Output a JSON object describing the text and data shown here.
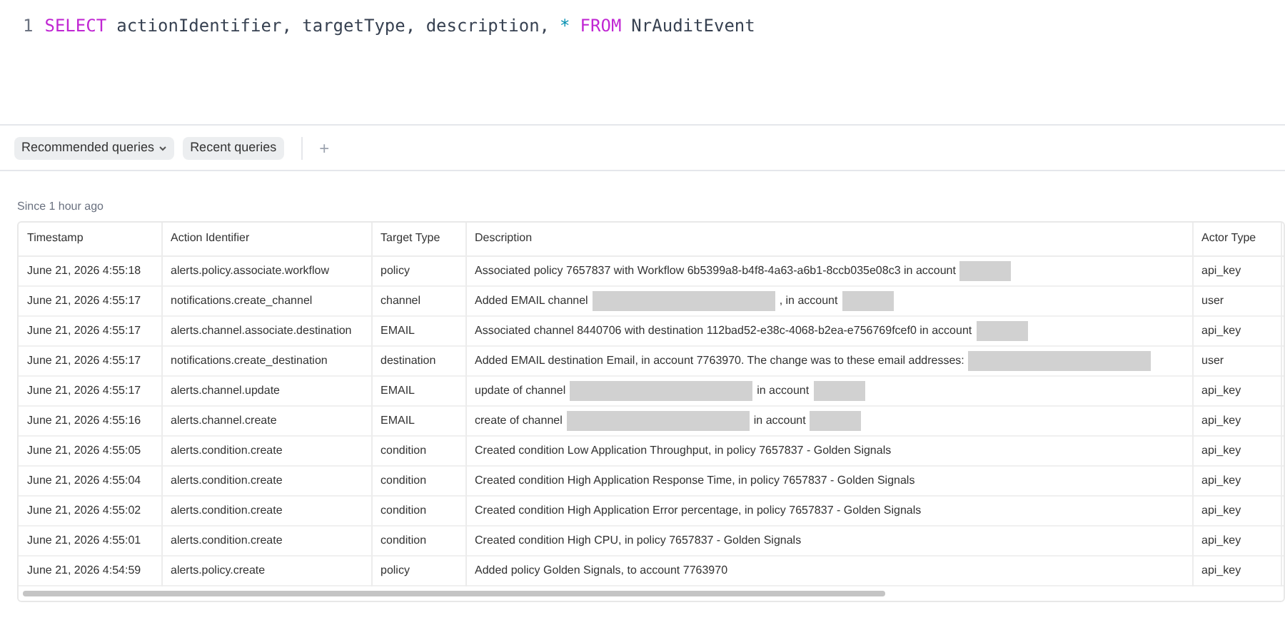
{
  "editor": {
    "line_number": "1",
    "tokens": [
      {
        "kind": "keyword",
        "text": "SELECT"
      },
      {
        "kind": "plain",
        "text": "actionIdentifier, targetType, description,"
      },
      {
        "kind": "operator",
        "text": "*"
      },
      {
        "kind": "keyword",
        "text": "FROM"
      },
      {
        "kind": "plain",
        "text": "NrAuditEvent"
      }
    ]
  },
  "query_buttons": [
    {
      "label": "Recommended queries",
      "dropdown": true
    },
    {
      "label": "Recent queries",
      "dropdown": false
    }
  ],
  "add_button": "+",
  "time_range": "Since 1 hour ago",
  "table": {
    "columns": [
      "Timestamp",
      "Action Identifier",
      "Target Type",
      "Description",
      "Actor Type"
    ],
    "rows": [
      {
        "timestamp": "June 21, 2026 4:55:18",
        "action": "alerts.policy.associate.workflow",
        "target": "policy",
        "description": [
          {
            "kind": "text",
            "text": "Associated policy 7657837 with Workflow 6b5399a8-b4f8-4a63-a6b1-8ccb035e08c3 in account"
          },
          {
            "kind": "redacted"
          }
        ],
        "actor": "api_key"
      },
      {
        "timestamp": "June 21, 2026 4:55:17",
        "action": "notifications.create_channel",
        "target": "channel",
        "description": [
          {
            "kind": "text",
            "text": "Added EMAIL channel"
          },
          {
            "kind": "longredacted"
          },
          {
            "kind": "text",
            "text": ", in account"
          },
          {
            "kind": "redacted"
          }
        ],
        "actor": "user"
      },
      {
        "timestamp": "June 21, 2026 4:55:17",
        "action": "alerts.channel.associate.destination",
        "target": "EMAIL",
        "description": [
          {
            "kind": "text",
            "text": "Associated channel 8440706 with destination 112bad52-e38c-4068-b2ea-e756769fcef0 in account"
          },
          {
            "kind": "redacted"
          }
        ],
        "actor": "api_key"
      },
      {
        "timestamp": "June 21, 2026 4:55:17",
        "action": "notifications.create_destination",
        "target": "destination",
        "description": [
          {
            "kind": "text",
            "text": "Added EMAIL destination Email, in account 7763970. The change was to these email addresses:"
          },
          {
            "kind": "longredacted"
          }
        ],
        "actor": "user"
      },
      {
        "timestamp": "June 21, 2026 4:55:17",
        "action": "alerts.channel.update",
        "target": "EMAIL",
        "description": [
          {
            "kind": "text",
            "text": "update of channel"
          },
          {
            "kind": "longredacted"
          },
          {
            "kind": "text",
            "text": "in account"
          },
          {
            "kind": "redacted"
          }
        ],
        "actor": "api_key"
      },
      {
        "timestamp": "June 21, 2026 4:55:16",
        "action": "alerts.channel.create",
        "target": "EMAIL",
        "description": [
          {
            "kind": "text",
            "text": "create of channel"
          },
          {
            "kind": "longredacted"
          },
          {
            "kind": "text",
            "text": "in account"
          },
          {
            "kind": "redacted"
          }
        ],
        "actor": "api_key"
      },
      {
        "timestamp": "June 21, 2026 4:55:05",
        "action": "alerts.condition.create",
        "target": "condition",
        "description": [
          {
            "kind": "text",
            "text": "Created condition Low Application Throughput, in policy 7657837 - Golden Signals"
          }
        ],
        "actor": "api_key"
      },
      {
        "timestamp": "June 21, 2026 4:55:04",
        "action": "alerts.condition.create",
        "target": "condition",
        "description": [
          {
            "kind": "text",
            "text": "Created condition High Application Response Time, in policy 7657837 - Golden Signals"
          }
        ],
        "actor": "api_key"
      },
      {
        "timestamp": "June 21, 2026 4:55:02",
        "action": "alerts.condition.create",
        "target": "condition",
        "description": [
          {
            "kind": "text",
            "text": "Created condition High Application Error percentage, in policy 7657837 - Golden Signals"
          }
        ],
        "actor": "api_key"
      },
      {
        "timestamp": "June 21, 2026 4:55:01",
        "action": "alerts.condition.create",
        "target": "condition",
        "description": [
          {
            "kind": "text",
            "text": "Created condition High CPU, in policy 7657837 - Golden Signals"
          }
        ],
        "actor": "api_key"
      },
      {
        "timestamp": "June 21, 2026 4:54:59",
        "action": "alerts.policy.create",
        "target": "policy",
        "description": [
          {
            "kind": "text",
            "text": "Added policy Golden Signals, to account 7763970"
          }
        ],
        "actor": "api_key"
      }
    ]
  }
}
